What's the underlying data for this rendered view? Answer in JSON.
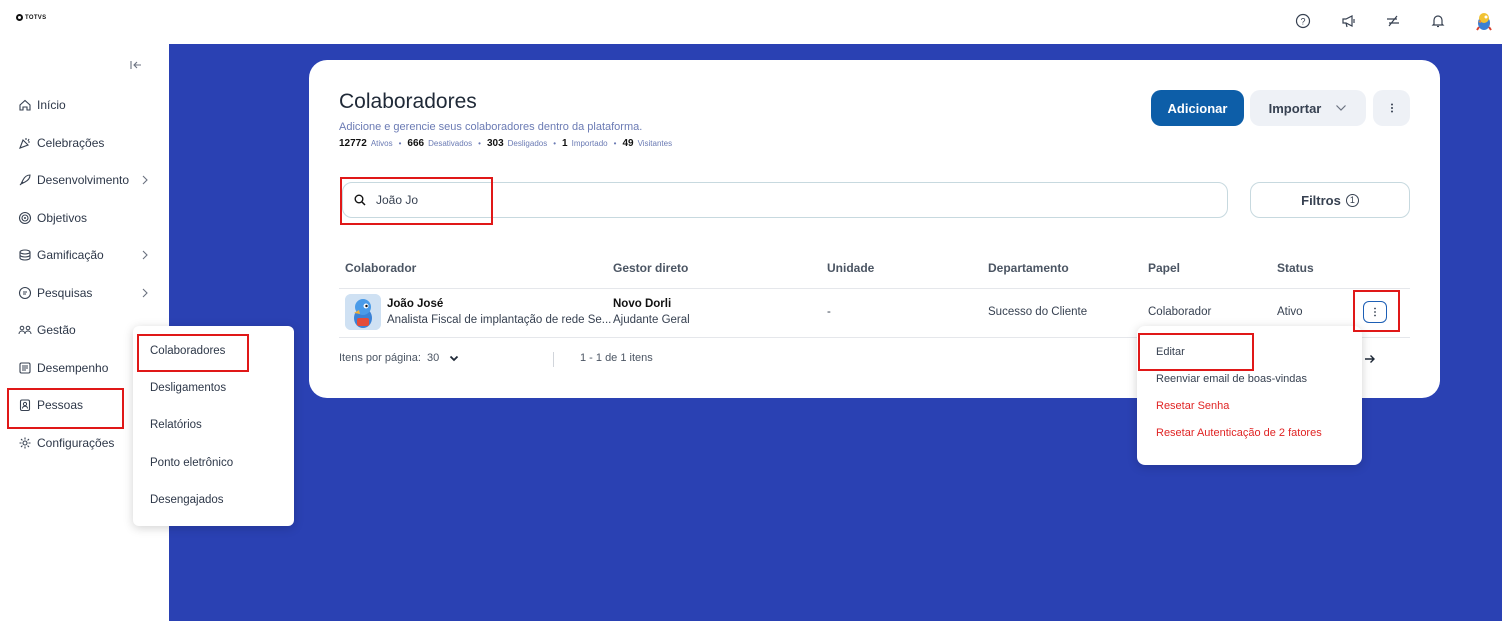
{
  "brand": {
    "logo_text": "TOTVS"
  },
  "topbar": {
    "icons": [
      "help-icon",
      "megaphone-icon",
      "integration-icon",
      "bell-icon",
      "user-avatar"
    ]
  },
  "sidebar": {
    "items": [
      {
        "label": "Início",
        "icon": "home-icon"
      },
      {
        "label": "Celebrações",
        "icon": "celebration-icon"
      },
      {
        "label": "Desenvolvimento",
        "icon": "rocket-icon",
        "has_submenu": true
      },
      {
        "label": "Objetivos",
        "icon": "target-icon"
      },
      {
        "label": "Gamificação",
        "icon": "coins-icon",
        "has_submenu": true
      },
      {
        "label": "Pesquisas",
        "icon": "survey-icon",
        "has_submenu": true
      },
      {
        "label": "Gestão",
        "icon": "team-icon"
      },
      {
        "label": "Desempenho",
        "icon": "performance-icon"
      },
      {
        "label": "Pessoas",
        "icon": "badge-icon",
        "active": true
      },
      {
        "label": "Configurações",
        "icon": "gear-icon"
      }
    ]
  },
  "submenu": {
    "items": [
      "Colaboradores",
      "Desligamentos",
      "Relatórios",
      "Ponto eletrônico",
      "Desengajados"
    ]
  },
  "page": {
    "title": "Colaboradores",
    "subtitle": "Adicione e gerencie seus colaboradores dentro da plataforma.",
    "stats": [
      {
        "num": "12772",
        "label": "Ativos"
      },
      {
        "num": "666",
        "label": "Desativados"
      },
      {
        "num": "303",
        "label": "Desligados"
      },
      {
        "num": "1",
        "label": "Importado"
      },
      {
        "num": "49",
        "label": "Visitantes"
      }
    ],
    "add_label": "Adicionar",
    "import_label": "Importar"
  },
  "search": {
    "value": "João Jo"
  },
  "filters": {
    "label": "Filtros",
    "count": "1"
  },
  "table": {
    "headers": [
      "Colaborador",
      "Gestor direto",
      "Unidade",
      "Departamento",
      "Papel",
      "Status"
    ],
    "rows": [
      {
        "name": "João José",
        "role": "Analista Fiscal de implantação de rede Se...",
        "manager": "Novo Dorli",
        "manager_role": "Ajudante Geral",
        "unit": "-",
        "department": "Sucesso do Cliente",
        "papel": "Colaborador",
        "status": "Ativo"
      }
    ]
  },
  "pagination": {
    "per_page_label": "Itens por página:",
    "per_page": "30",
    "range": "1 - 1 de 1 itens"
  },
  "row_menu": {
    "items": [
      {
        "label": "Editar",
        "danger": false
      },
      {
        "label": "Reenviar email de boas-vindas",
        "danger": false
      },
      {
        "label": "Resetar Senha",
        "danger": true
      },
      {
        "label": "Resetar Autenticação de 2 fatores",
        "danger": true
      }
    ]
  },
  "colors": {
    "brand_blue": "#0d5ea8",
    "background_blue": "#2a41b3",
    "danger": "#e02424",
    "highlight": "#e01818"
  }
}
